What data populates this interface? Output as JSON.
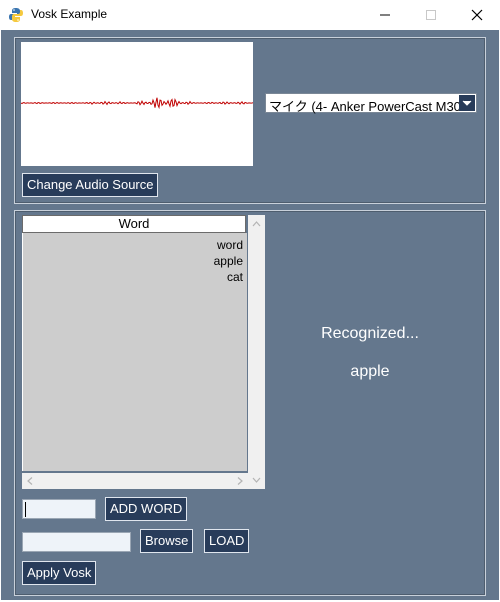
{
  "window": {
    "title": "Vosk Example",
    "icon": "python-icon"
  },
  "audio": {
    "device_selected": "マイク (4- Anker PowerCast M30",
    "change_source_label": "Change Audio Source"
  },
  "table": {
    "header": "Word",
    "rows": [
      "word",
      "apple",
      "cat"
    ]
  },
  "controls": {
    "word_input_value": "",
    "add_word_label": "ADD WORD",
    "file_input_value": "",
    "browse_label": "Browse",
    "load_label": "LOAD",
    "apply_label": "Apply Vosk"
  },
  "status": {
    "title": "Recognized...",
    "result": "apple"
  },
  "colors": {
    "background": "#64778d",
    "button": "#283c5a",
    "waveform": "#c00000"
  }
}
